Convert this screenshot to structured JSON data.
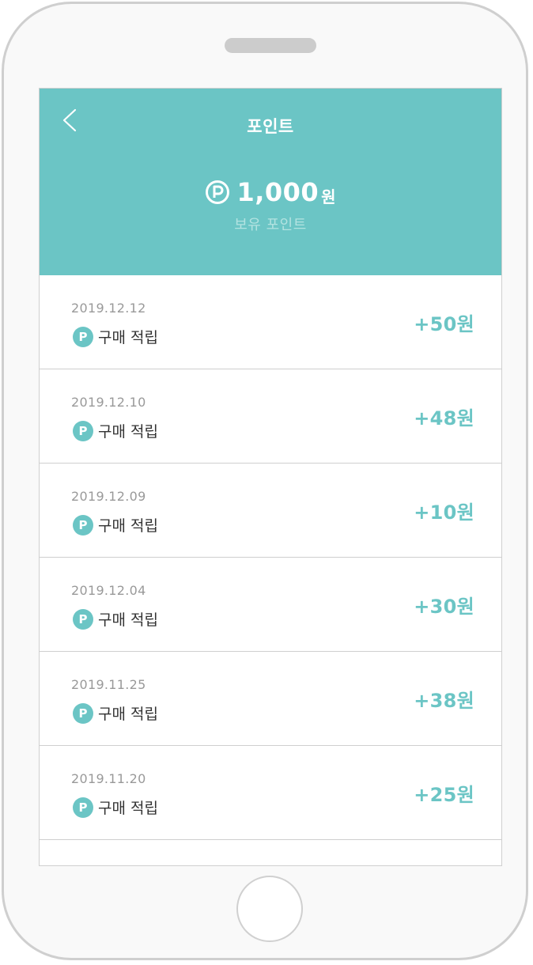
{
  "header": {
    "title": "포인트",
    "back_icon": "chevron-left-icon",
    "balance_icon": "point-circle-icon",
    "balance_amount": "1,000",
    "balance_unit": "원",
    "balance_caption": "보유 포인트"
  },
  "colors": {
    "accent": "#6bc5c5",
    "caption": "#b3e3e1",
    "date_text": "#999999",
    "label_text": "#333333"
  },
  "history": [
    {
      "date": "2019.12.12",
      "badge": "P",
      "label": "구매 적립",
      "amount": "+50원"
    },
    {
      "date": "2019.12.10",
      "badge": "P",
      "label": "구매 적립",
      "amount": "+48원"
    },
    {
      "date": "2019.12.09",
      "badge": "P",
      "label": "구매 적립",
      "amount": "+10원"
    },
    {
      "date": "2019.12.04",
      "badge": "P",
      "label": "구매 적립",
      "amount": "+30원"
    },
    {
      "date": "2019.11.25",
      "badge": "P",
      "label": "구매 적립",
      "amount": "+38원"
    },
    {
      "date": "2019.11.20",
      "badge": "P",
      "label": "구매 적립",
      "amount": "+25원"
    }
  ]
}
